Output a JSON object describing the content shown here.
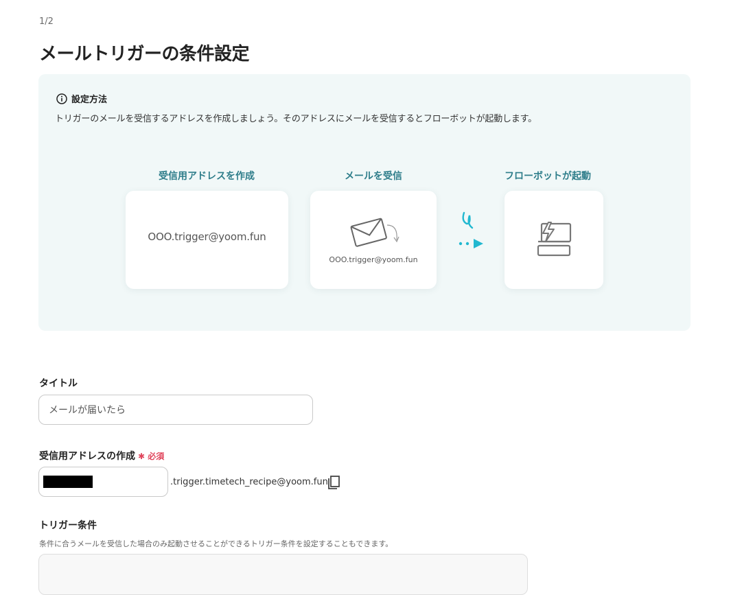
{
  "step": "1/2",
  "title": "メールトリガーの条件設定",
  "info": {
    "heading": "設定方法",
    "description": "トリガーのメールを受信するアドレスを作成しましょう。そのアドレスにメールを受信するとフローボットが起動します。",
    "steps": [
      {
        "label": "受信用アドレスを作成",
        "card_text": "OOO.trigger@yoom.fun"
      },
      {
        "label": "メールを受信",
        "card_text": "OOO.trigger@yoom.fun",
        "icon": "envelope-icon"
      },
      {
        "label": "フローボットが起動",
        "icon": "flowbot-icon"
      }
    ],
    "accent_color": "#2e7d8a",
    "arrow_color": "#22b8d0"
  },
  "form": {
    "title_label": "タイトル",
    "title_value": "メールが届いたら",
    "address_label": "受信用アドレスの作成",
    "required_mark": "✱ 必須",
    "address_suffix": ".trigger.timetech_recipe@yoom.fun",
    "trigger_label": "トリガー条件",
    "trigger_hint": "条件に合うメールを受信した場合のみ起動させることができるトリガー条件を設定することもできます。"
  }
}
